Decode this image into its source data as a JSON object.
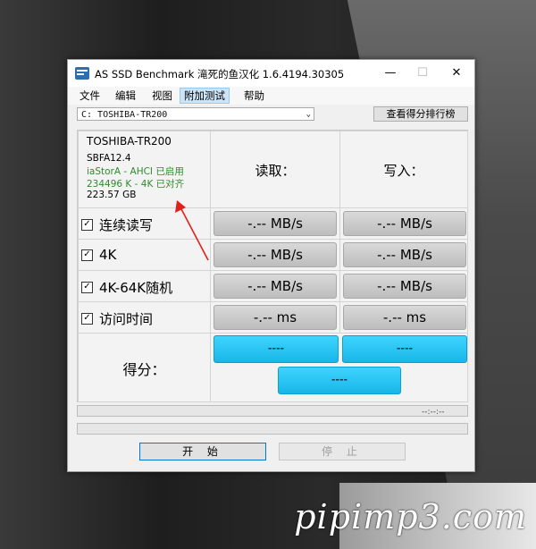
{
  "window": {
    "title": "AS SSD Benchmark 滝死的鱼汉化 1.6.4194.30305",
    "min_glyph": "—",
    "max_glyph": "☐",
    "close_glyph": "✕"
  },
  "menu": [
    "文件",
    "编辑",
    "视图",
    "附加测试",
    "帮助"
  ],
  "menu_active_index": 3,
  "drive": {
    "selected": "C: TOSHIBA-TR200",
    "arrow": "⌄",
    "rank_button": "查看得分排行榜"
  },
  "info": {
    "model": "TOSHIBA-TR200",
    "firmware": "SBFA12.4",
    "driver_status": "iaStorA - AHCI 已启用",
    "alignment": "234496 K - 4K 已对齐",
    "capacity": "223.57 GB"
  },
  "columns": {
    "read": "读取：",
    "write": "写入："
  },
  "rows": [
    {
      "label": "连续读写",
      "read": "-.-- MB/s",
      "write": "-.-- MB/s"
    },
    {
      "label": "4K",
      "read": "-.-- MB/s",
      "write": "-.-- MB/s"
    },
    {
      "label": "4K-64K随机",
      "read": "-.-- MB/s",
      "write": "-.-- MB/s"
    },
    {
      "label": "访问时间",
      "read": "-.-- ms",
      "write": "-.-- ms"
    }
  ],
  "score": {
    "label": "得分：",
    "read": "----",
    "write": "----",
    "total": "----"
  },
  "time_text": "--:--:--",
  "buttons": {
    "start": "开 始",
    "stop": "停 止"
  },
  "watermark": "pipimp3.com",
  "colors": {
    "ok_green": "#2e8b2e",
    "score_blue": "#1fc0f0",
    "accent_blue": "#0078d7",
    "annotation_red": "#e0201a"
  }
}
